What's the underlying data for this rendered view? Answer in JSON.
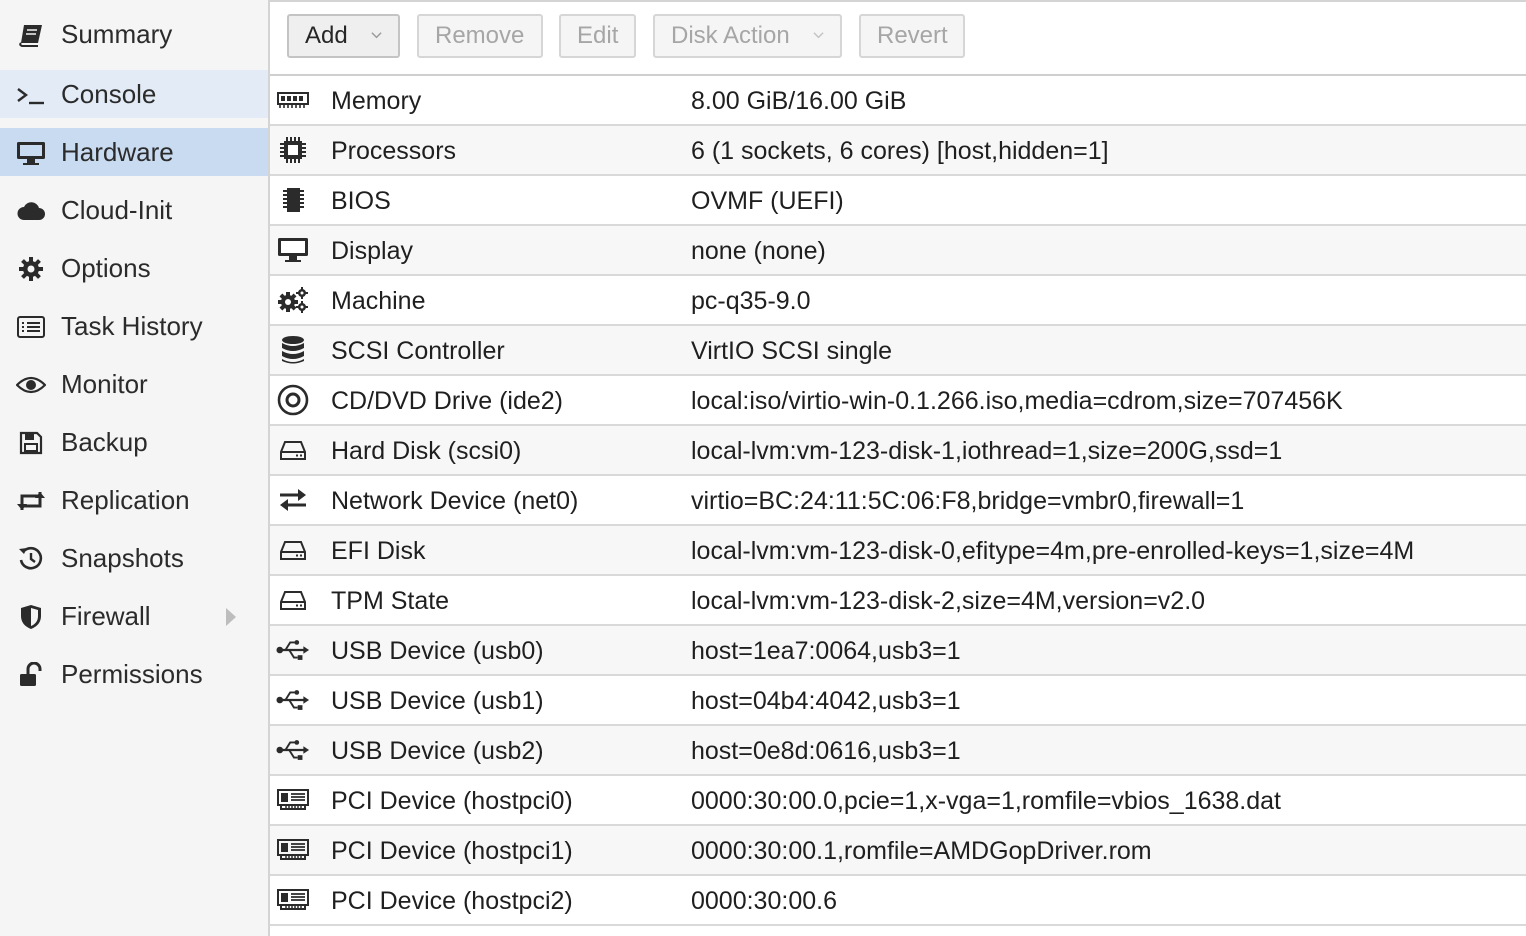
{
  "sidebar": {
    "items": [
      {
        "label": "Summary",
        "icon": "book-icon"
      },
      {
        "label": "Console",
        "icon": "terminal-icon"
      },
      {
        "label": "Hardware",
        "icon": "desktop-icon"
      },
      {
        "label": "Cloud-Init",
        "icon": "cloud-icon"
      },
      {
        "label": "Options",
        "icon": "gear-icon"
      },
      {
        "label": "Task History",
        "icon": "list-icon"
      },
      {
        "label": "Monitor",
        "icon": "eye-icon"
      },
      {
        "label": "Backup",
        "icon": "floppy-icon"
      },
      {
        "label": "Replication",
        "icon": "retweet-icon"
      },
      {
        "label": "Snapshots",
        "icon": "history-icon"
      },
      {
        "label": "Firewall",
        "icon": "shield-icon"
      },
      {
        "label": "Permissions",
        "icon": "unlock-icon"
      }
    ],
    "active": "Hardware",
    "hover": "Console"
  },
  "toolbar": {
    "add_label": "Add",
    "remove_label": "Remove",
    "edit_label": "Edit",
    "disk_action_label": "Disk Action",
    "revert_label": "Revert"
  },
  "hardware": {
    "rows": [
      {
        "name": "Memory",
        "value": "8.00 GiB/16.00 GiB",
        "icon": "memory-icon"
      },
      {
        "name": "Processors",
        "value": "6 (1 sockets, 6 cores) [host,hidden=1]",
        "icon": "cpu-icon"
      },
      {
        "name": "BIOS",
        "value": "OVMF (UEFI)",
        "icon": "microchip-icon"
      },
      {
        "name": "Display",
        "value": "none (none)",
        "icon": "desktop-icon"
      },
      {
        "name": "Machine",
        "value": "pc-q35-9.0",
        "icon": "cogs-icon"
      },
      {
        "name": "SCSI Controller",
        "value": "VirtIO SCSI single",
        "icon": "database-icon"
      },
      {
        "name": "CD/DVD Drive (ide2)",
        "value": "local:iso/virtio-win-0.1.266.iso,media=cdrom,size=707456K",
        "icon": "cdrom-icon"
      },
      {
        "name": "Hard Disk (scsi0)",
        "value": "local-lvm:vm-123-disk-1,iothread=1,size=200G,ssd=1",
        "icon": "hdd-icon"
      },
      {
        "name": "Network Device (net0)",
        "value": "virtio=BC:24:11:5C:06:F8,bridge=vmbr0,firewall=1",
        "icon": "exchange-icon"
      },
      {
        "name": "EFI Disk",
        "value": "local-lvm:vm-123-disk-0,efitype=4m,pre-enrolled-keys=1,size=4M",
        "icon": "hdd-icon"
      },
      {
        "name": "TPM State",
        "value": "local-lvm:vm-123-disk-2,size=4M,version=v2.0",
        "icon": "hdd-icon"
      },
      {
        "name": "USB Device (usb0)",
        "value": "host=1ea7:0064,usb3=1",
        "icon": "usb-icon"
      },
      {
        "name": "USB Device (usb1)",
        "value": "host=04b4:4042,usb3=1",
        "icon": "usb-icon"
      },
      {
        "name": "USB Device (usb2)",
        "value": "host=0e8d:0616,usb3=1",
        "icon": "usb-icon"
      },
      {
        "name": "PCI Device (hostpci0)",
        "value": "0000:30:00.0,pcie=1,x-vga=1,romfile=vbios_1638.dat",
        "icon": "pci-card-icon"
      },
      {
        "name": "PCI Device (hostpci1)",
        "value": "0000:30:00.1,romfile=AMDGopDriver.rom",
        "icon": "pci-card-icon"
      },
      {
        "name": "PCI Device (hostpci2)",
        "value": "0000:30:00.6",
        "icon": "pci-card-icon"
      }
    ]
  },
  "colors": {
    "sidebar_bg": "#f5f5f5",
    "active_bg": "#c9dbf0",
    "hover_bg": "#e3ecf6",
    "row_alt_bg": "#f7f7f7",
    "border": "#d9d9d9"
  }
}
